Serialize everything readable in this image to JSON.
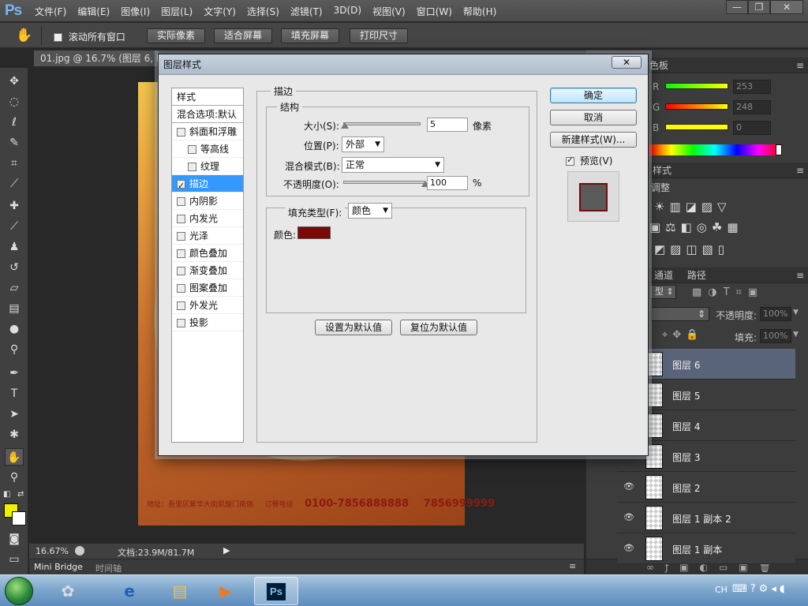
{
  "app": {
    "logo": "Ps"
  },
  "menu": [
    "文件(F)",
    "编辑(E)",
    "图像(I)",
    "图层(L)",
    "文字(Y)",
    "选择(S)",
    "滤镜(T)",
    "3D(D)",
    "视图(V)",
    "窗口(W)",
    "帮助(H)"
  ],
  "window_controls": {
    "minimize": "—",
    "restore": "❐",
    "close": "✕"
  },
  "options_bar": {
    "scroll_all_label": "滚动所有窗口",
    "buttons": [
      "实际像素",
      "适合屏幕",
      "填充屏幕",
      "打印尺寸"
    ]
  },
  "document": {
    "tab_title": "01.jpg @ 16.7% (图层 6, RG",
    "footer_small": "地址：吾里区紫华大街凯旋门南侧",
    "footer_label": "订餐电话",
    "phone1": "0100-7856888888",
    "phone2": "7856999999"
  },
  "status": {
    "zoom": "16.67%",
    "doc_size": "文档:23.9M/81.7M"
  },
  "bottom_tabs": [
    "Mini Bridge",
    "时间轴"
  ],
  "right_panel": {
    "color_tab": "色板",
    "channels": [
      {
        "label": "R",
        "value": "253",
        "color": "#fd0000"
      },
      {
        "label": "G",
        "value": "248",
        "color": "#00f800"
      },
      {
        "label": "B",
        "value": "0",
        "color": "#0000ff"
      }
    ],
    "styles_tab": "样式",
    "adjust_label": "调整",
    "layers_tabs": [
      "通道",
      "路径"
    ],
    "kind_label": "型",
    "opacity_label": "不透明度:",
    "opacity_value": "100%",
    "fill_label": "填充:",
    "fill_value": "100%",
    "layers": [
      {
        "name": "图层 6",
        "selected": true,
        "visible": false
      },
      {
        "name": "图层 5",
        "selected": false,
        "visible": false
      },
      {
        "name": "图层 4",
        "selected": false,
        "visible": false
      },
      {
        "name": "图层 3",
        "selected": false,
        "visible": false
      },
      {
        "name": "图层 2",
        "selected": false,
        "visible": true
      },
      {
        "name": "图层 1 副本 2",
        "selected": false,
        "visible": true
      },
      {
        "name": "图层 1 副本",
        "selected": false,
        "visible": true
      }
    ]
  },
  "dialog": {
    "title": "图层样式",
    "close": "✕",
    "styles_header": "样式",
    "blend_options": "混合选项:默认",
    "style_items": [
      {
        "label": "斜面和浮雕",
        "checked": false,
        "indent": false,
        "selected": false
      },
      {
        "label": "等高线",
        "checked": false,
        "indent": true,
        "selected": false
      },
      {
        "label": "纹理",
        "checked": false,
        "indent": true,
        "selected": false
      },
      {
        "label": "描边",
        "checked": true,
        "indent": false,
        "selected": true
      },
      {
        "label": "内阴影",
        "checked": false,
        "indent": false,
        "selected": false
      },
      {
        "label": "内发光",
        "checked": false,
        "indent": false,
        "selected": false
      },
      {
        "label": "光泽",
        "checked": false,
        "indent": false,
        "selected": false
      },
      {
        "label": "颜色叠加",
        "checked": false,
        "indent": false,
        "selected": false
      },
      {
        "label": "渐变叠加",
        "checked": false,
        "indent": false,
        "selected": false
      },
      {
        "label": "图案叠加",
        "checked": false,
        "indent": false,
        "selected": false
      },
      {
        "label": "外发光",
        "checked": false,
        "indent": false,
        "selected": false
      },
      {
        "label": "投影",
        "checked": false,
        "indent": false,
        "selected": false
      }
    ],
    "section_title": "描边",
    "structure_title": "结构",
    "size_label": "大小(S):",
    "size_value": "5",
    "size_level": 0.02,
    "size_unit": "像素",
    "position_label": "位置(P):",
    "position_value": "外部",
    "blend_mode_label": "混合模式(B):",
    "blend_mode_value": "正常",
    "opacity_label": "不透明度(O):",
    "opacity_value": "100",
    "opacity_level": 1.0,
    "opacity_unit": "%",
    "fill_type_label": "填充类型(F):",
    "fill_type_value": "颜色",
    "color_label": "颜色:",
    "stroke_color": "#7a0a08",
    "set_default": "设置为默认值",
    "reset_default": "复位为默认值",
    "ok": "确定",
    "cancel": "取消",
    "new_style": "新建样式(W)...",
    "preview_label": "预览(V)"
  },
  "taskbar": {
    "lang": "CH"
  }
}
